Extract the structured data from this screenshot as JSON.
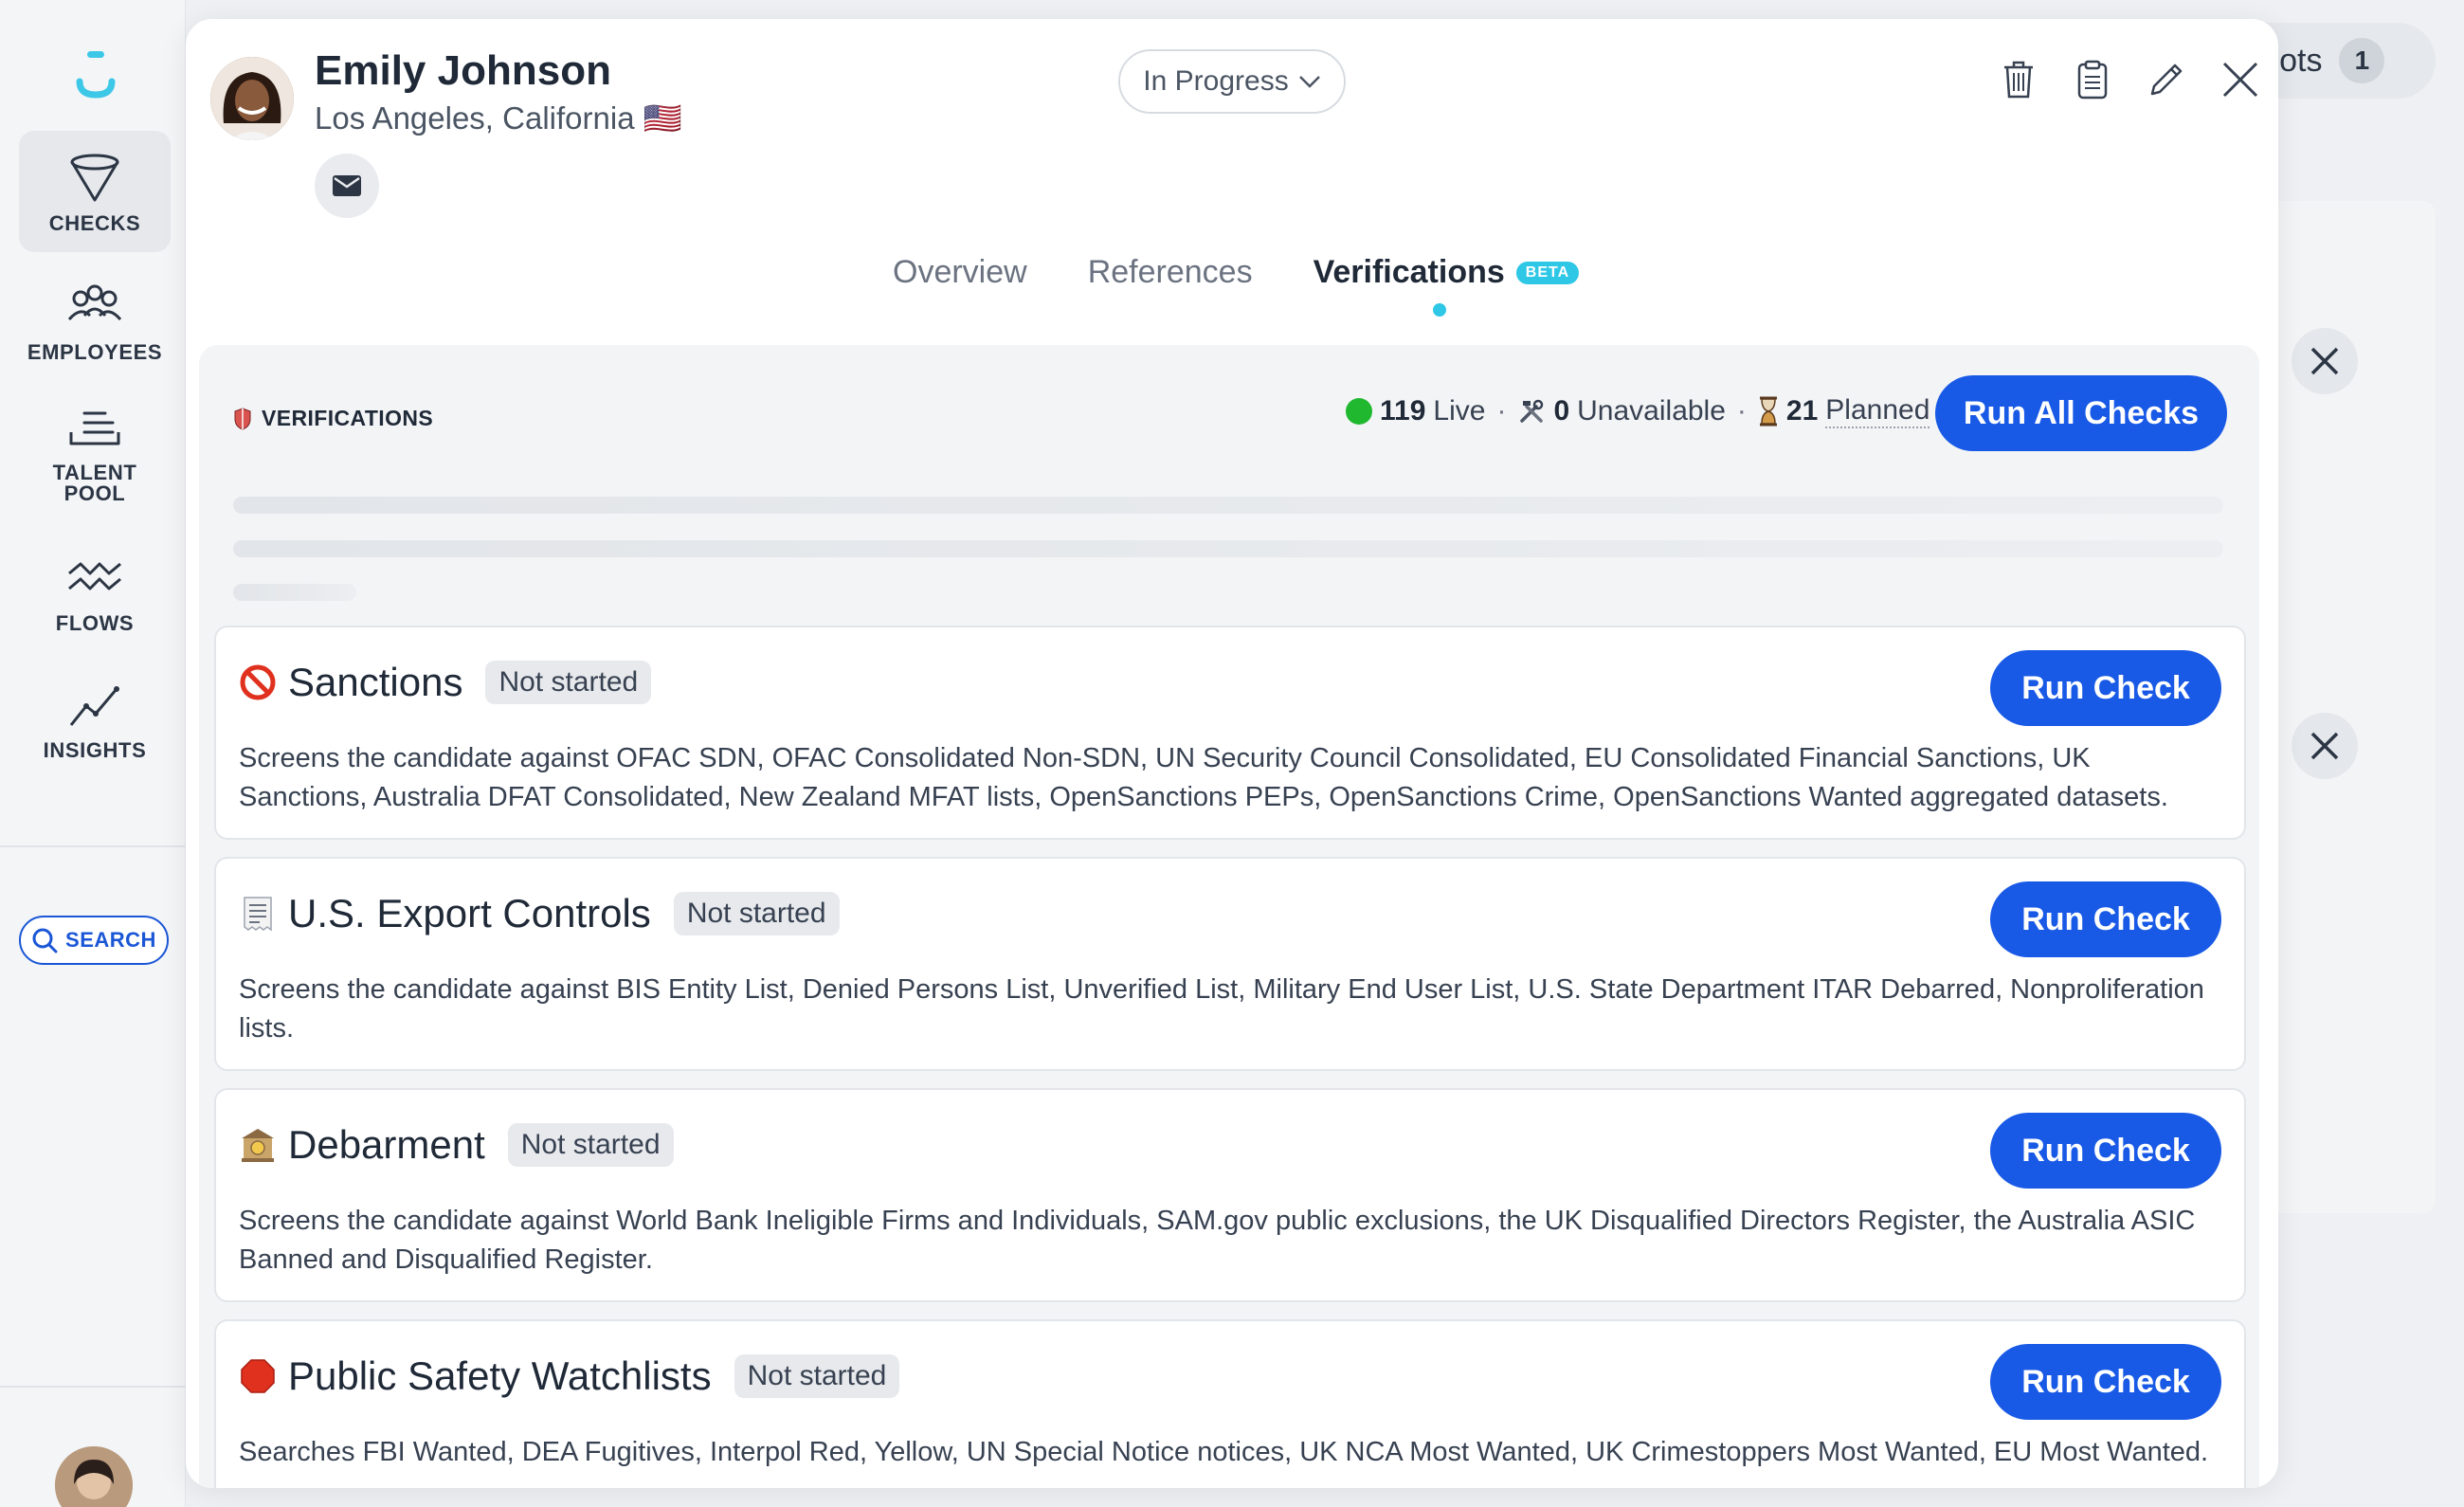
{
  "sidebar": {
    "items": [
      {
        "label": "CHECKS",
        "icon": "funnel-icon"
      },
      {
        "label": "EMPLOYEES",
        "icon": "people-icon"
      },
      {
        "label": "TALENT\nPOOL",
        "icon": "tray-icon"
      },
      {
        "label": "FLOWS",
        "icon": "waves-icon"
      },
      {
        "label": "INSIGHTS",
        "icon": "chart-line-icon"
      }
    ],
    "search_label": "SEARCH"
  },
  "background": {
    "pill_text": "ilots",
    "pill_count": "1"
  },
  "candidate": {
    "name": "Emily Johnson",
    "location": "Los Angeles, California",
    "flag": "🇺🇸",
    "status": "In Progress"
  },
  "tabs": [
    {
      "label": "Overview"
    },
    {
      "label": "References"
    },
    {
      "label": "Verifications",
      "badge": "BETA"
    }
  ],
  "verifications": {
    "title": "VERIFICATIONS",
    "live_count": "119",
    "live_label": "Live",
    "unavailable_count": "0",
    "unavailable_label": "Unavailable",
    "planned_count": "21",
    "planned_label": "Planned",
    "run_all_label": "Run All Checks",
    "checks": [
      {
        "title": "Sanctions",
        "status": "Not started",
        "button": "Run Check",
        "description": "Screens the candidate against OFAC SDN, OFAC Consolidated Non-SDN, UN Security Council Consolidated, EU Consolidated Financial Sanctions, UK Sanctions, Australia DFAT Consolidated, New Zealand MFAT lists, OpenSanctions PEPs, OpenSanctions Crime, OpenSanctions Wanted aggregated datasets."
      },
      {
        "title": "U.S. Export Controls",
        "status": "Not started",
        "button": "Run Check",
        "description": "Screens the candidate against BIS Entity List, Denied Persons List, Unverified List, Military End User List, U.S. State Department ITAR Debarred, Nonproliferation lists."
      },
      {
        "title": "Debarment",
        "status": "Not started",
        "button": "Run Check",
        "description": "Screens the candidate against World Bank Ineligible Firms and Individuals, SAM.gov public exclusions, the UK Disqualified Directors Register, the Australia ASIC Banned and Disqualified Register."
      },
      {
        "title": "Public Safety Watchlists",
        "status": "Not started",
        "button": "Run Check",
        "description": "Searches FBI Wanted, DEA Fugitives, Interpol Red, Yellow, UN Special Notice notices, UK NCA Most Wanted, UK Crimestoppers Most Wanted, EU Most Wanted."
      }
    ]
  }
}
